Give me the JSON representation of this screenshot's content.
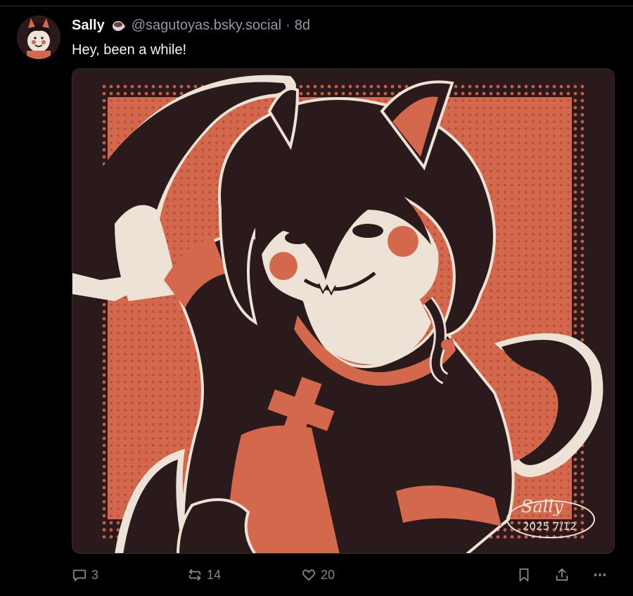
{
  "post": {
    "author": {
      "display_name": "Sally",
      "badge_icon": "coffee-cup-icon",
      "handle": "@sagutoyas.bsky.social",
      "separator": "·",
      "time": "8d"
    },
    "text": "Hey, been a while!",
    "image": {
      "signature": "Sally",
      "signature_date": "2025 7/12"
    },
    "actions": {
      "replies": "3",
      "reposts": "14",
      "likes": "20"
    }
  },
  "colors": {
    "background": "#000000",
    "text": "#f1f3f5",
    "muted": "#8c9aab",
    "art_orange": "#d4684c",
    "art_dark": "#2b1a1c",
    "art_cream": "#ece3d6"
  }
}
